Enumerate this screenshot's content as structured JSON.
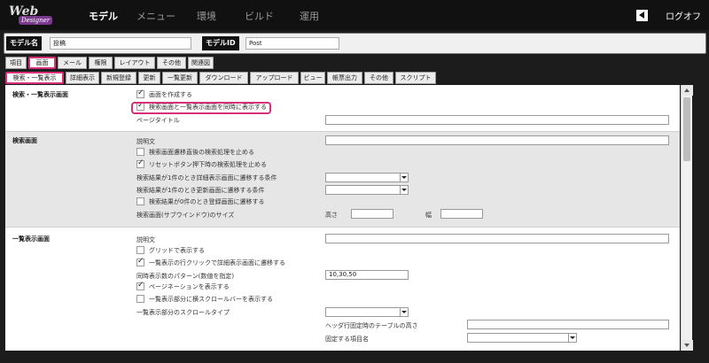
{
  "logo": {
    "line1": "Web",
    "line2": "Designer"
  },
  "nav": {
    "items": [
      "モデル",
      "メニュー",
      "環境",
      "ビルド",
      "運用"
    ],
    "active": "モデル"
  },
  "logoff": "ログオフ",
  "model": {
    "name_label": "モデル名",
    "name_value": "投稿",
    "id_label": "モデルID",
    "id_value": "Post"
  },
  "tabs1": [
    "項目",
    "画面",
    "メール",
    "権限",
    "レイアウト",
    "その他",
    "関連図"
  ],
  "tabs2": [
    "検索・一覧表示",
    "詳細表示",
    "新規登録",
    "更新",
    "一覧更新",
    "ダウンロード",
    "アップロード",
    "ビュー",
    "帳票出力",
    "その他",
    "スクリプト"
  ],
  "sections": {
    "search_list": {
      "title": "検索・一覧表示画面",
      "create_screen": "画面を作成する",
      "same_screen": "検索画面と一覧表示画面を同時に表示する",
      "page_title": "ページタイトル"
    },
    "search": {
      "title": "検索画面",
      "description": "説明文",
      "stop_after_move": "検索画面遷移直後の検索処理を止める",
      "stop_after_reset": "リセットボタン押下時の検索処理を止める",
      "one_result_detail": "検索結果が1件のとき詳細表示画面に遷移する条件",
      "one_result_update": "検索結果が1件のとき更新画面に遷移する条件",
      "zero_result_register": "検索結果が0件のとき登録画面に遷移する",
      "subwindow_size": "検索画面(サブウインドウ)のサイズ",
      "height": "高さ",
      "width": "幅"
    },
    "list": {
      "title": "一覧表示画面",
      "description": "説明文",
      "grid_display": "グリッドで表示する",
      "row_click_detail": "一覧表示の行クリックで詳細表示画面に遷移する",
      "count_pattern": "同時表示数のパターン(数値を指定)",
      "count_pattern_value": "10,30,50",
      "paging": "ページネーションを表示する",
      "h_scrollbar": "一覧表示部分に横スクロールバーを表示する",
      "scroll_type": "一覧表示部分のスクロールタイプ",
      "header_table_height": "ヘッダ行固定時のテーブルの高さ",
      "fixed_columns": "固定する項目名"
    }
  }
}
